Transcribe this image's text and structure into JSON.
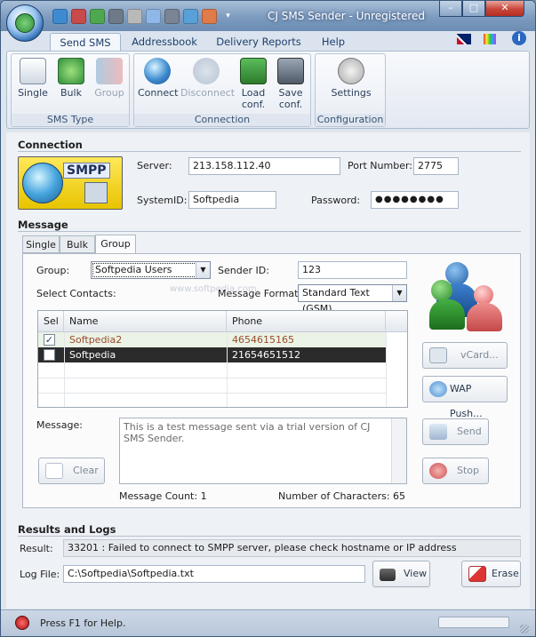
{
  "title": "CJ SMS Sender - Unregistered",
  "window_buttons": {
    "minimize": "–",
    "maximize": "□",
    "close": "✕"
  },
  "ribbon_tabs": [
    "Send SMS",
    "Addressbook",
    "Delivery Reports",
    "Help"
  ],
  "ribbon": {
    "sms_type": {
      "label": "SMS Type",
      "single": "Single",
      "bulk": "Bulk",
      "group": "Group"
    },
    "connection": {
      "label": "Connection",
      "connect": "Connect",
      "disconnect": "Disconnect",
      "load": "Load\nconf.",
      "save": "Save\nconf."
    },
    "configuration": {
      "label": "Configuration",
      "settings": "Settings"
    }
  },
  "connection_section": {
    "heading": "Connection",
    "logo_text": "SMPP",
    "server_label": "Server:",
    "server_value": "213.158.112.40",
    "port_label": "Port Number:",
    "port_value": "2775",
    "systemid_label": "SystemID:",
    "systemid_value": "Softpedia",
    "password_label": "Password:",
    "password_value": "●●●●●●●●"
  },
  "message_section": {
    "heading": "Message",
    "tabs": [
      "Single",
      "Bulk",
      "Group"
    ],
    "group_label": "Group:",
    "group_value": "Softpedia Users",
    "sender_label": "Sender ID:",
    "sender_value": "123",
    "select_contacts_label": "Select Contacts:",
    "format_label": "Message Format:",
    "format_value": "Standard Text (GSM)",
    "watermark": "www.softpedia.com",
    "grid": {
      "columns": [
        "Sel",
        "Name",
        "Phone"
      ],
      "rows": [
        {
          "checked": true,
          "name": "Softpedia2",
          "phone": "4654615165"
        },
        {
          "checked": false,
          "name": "Softpedia",
          "phone": "21654651512"
        }
      ]
    },
    "vcard_label": "vCard...",
    "wap_label": "WAP Push...",
    "message_label": "Message:",
    "message_text": "This is a test message sent via a trial version of CJ SMS Sender.",
    "clear_label": "Clear",
    "send_label": "Send",
    "stop_label": "Stop",
    "count_label": "Message Count: 1",
    "chars_label": "Number of Characters: 65"
  },
  "results": {
    "heading": "Results and Logs",
    "result_label": "Result:",
    "result_value": "33201 : Failed to connect to SMPP server, please check hostname or IP address",
    "logfile_label": "Log File:",
    "logfile_value": "C:\\Softpedia\\Softpedia.txt",
    "view_label": "View",
    "erase_label": "Erase"
  },
  "status": {
    "text": "Press F1 for Help."
  },
  "colors": {
    "accent": "#4a79b2",
    "selected_row": "#2b2b2b",
    "row_highlight": "#eaf3e6"
  }
}
